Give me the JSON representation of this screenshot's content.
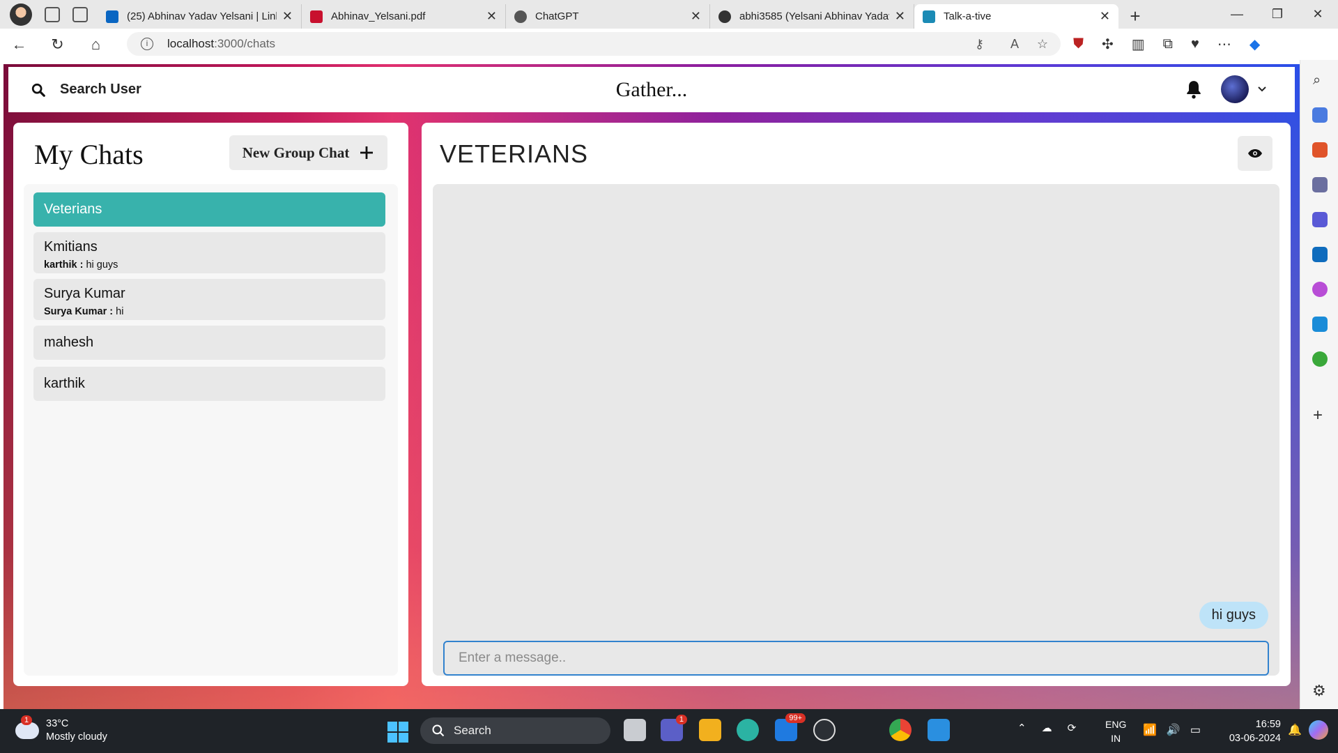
{
  "browser": {
    "tabs": [
      {
        "title": "(25) Abhinav Yadav Yelsani | LinkedIn",
        "favicon_color": "#0a66c2"
      },
      {
        "title": "Abhinav_Yelsani.pdf",
        "favicon_color": "#c8102e"
      },
      {
        "title": "ChatGPT",
        "favicon_color": "#555555"
      },
      {
        "title": "abhi3585 (Yelsani Abhinav Yadav)",
        "favicon_color": "#333333"
      },
      {
        "title": "Talk-a-tive",
        "favicon_color": "#1b8bb5"
      }
    ],
    "url_host": "localhost",
    "url_path": ":3000/chats"
  },
  "app": {
    "search_label": "Search User",
    "brand": "Gather...",
    "my_chats_title": "My Chats",
    "new_group_label": "New Group Chat",
    "chats": [
      {
        "name": "Veterians",
        "sender": "",
        "message": "",
        "selected": true
      },
      {
        "name": "Kmitians",
        "sender": "karthik :",
        "message": "hi guys",
        "selected": false
      },
      {
        "name": "Surya Kumar",
        "sender": "Surya Kumar :",
        "message": "hi",
        "selected": false
      },
      {
        "name": "mahesh",
        "sender": "",
        "message": "",
        "selected": false
      },
      {
        "name": "karthik",
        "sender": "",
        "message": "",
        "selected": false
      }
    ],
    "active_chat_title": "VETERIANS",
    "messages": [
      {
        "text": "hi guys",
        "own": true
      }
    ],
    "input_placeholder": "Enter a message..",
    "accent": "#38b2ac",
    "bubble_color": "#bee3f8"
  },
  "taskbar": {
    "temperature": "33°C",
    "weather": "Mostly cloudy",
    "weather_badge": "1",
    "search_label": "Search",
    "teams_badge": "1",
    "mail_badge": "99+",
    "lang_top": "ENG",
    "lang_bottom": "IN",
    "time": "16:59",
    "date": "03-06-2024"
  }
}
